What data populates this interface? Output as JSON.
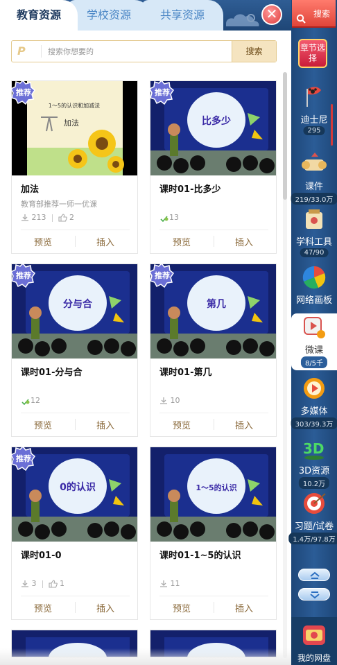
{
  "tabs": [
    {
      "label": "教育资源",
      "active": true
    },
    {
      "label": "学校资源",
      "active": false
    },
    {
      "label": "共享资源",
      "active": false
    }
  ],
  "close_symbol": "✕",
  "search": {
    "logo": "P",
    "placeholder": "搜索你想要的",
    "button_label": "搜索"
  },
  "badge_label": "推荐",
  "cards": [
    {
      "title": "加法",
      "subtitle": "教育部推荐一师一优课",
      "downloads": "213",
      "likes": "2",
      "views": "",
      "recommended": true,
      "thumb_text": "加法",
      "thumb_caption": "1～5的认识和加减法"
    },
    {
      "title": "课时01-比多少",
      "subtitle": "",
      "downloads": "",
      "likes": "",
      "views": "13",
      "recommended": true,
      "thumb_text": "比多少"
    },
    {
      "title": "课时01-分与合",
      "subtitle": "",
      "downloads": "",
      "likes": "",
      "views": "12",
      "recommended": true,
      "thumb_text": "分与合"
    },
    {
      "title": "课时01-第几",
      "subtitle": "",
      "downloads": "10",
      "likes": "",
      "views": "",
      "recommended": true,
      "thumb_text": "第几"
    },
    {
      "title": "课时01-0",
      "subtitle": "",
      "downloads": "3",
      "likes": "1",
      "views": "",
      "recommended": true,
      "thumb_text": "0的认识"
    },
    {
      "title": "课时01-1~5的认识",
      "subtitle": "",
      "downloads": "11",
      "likes": "",
      "views": "",
      "recommended": false,
      "thumb_text": "1～5的认识"
    }
  ],
  "card_actions": {
    "preview": "预览",
    "insert": "插入"
  },
  "sidebar": {
    "search_label": "搜索",
    "chapter_select": "章节选择",
    "items": [
      {
        "label": "迪士尼",
        "count": "295",
        "icon": "disney-flag-icon"
      },
      {
        "label": "课件",
        "count": "219/33.0万",
        "icon": "courseware-scroll-icon"
      },
      {
        "label": "学科工具",
        "count": "47/90",
        "icon": "subject-tools-icon"
      },
      {
        "label": "网络画板",
        "count": "",
        "icon": "network-sketchpad-icon"
      },
      {
        "label": "微课",
        "count": "8/5千",
        "icon": "micro-lesson-icon",
        "active": true
      },
      {
        "label": "多媒体",
        "count": "303/39.3万",
        "icon": "multimedia-icon"
      },
      {
        "label": "3D资源",
        "count": "10.2万",
        "icon": "3d-resource-icon"
      },
      {
        "label": "习题/试卷",
        "count": "1.4万/97.8万",
        "icon": "exercise-target-icon"
      }
    ],
    "netdisk_label": "我的网盘"
  },
  "colors": {
    "accent": "#2b5c96",
    "brand_gold": "#8b6a3b",
    "badge": "#6b6fd6"
  }
}
